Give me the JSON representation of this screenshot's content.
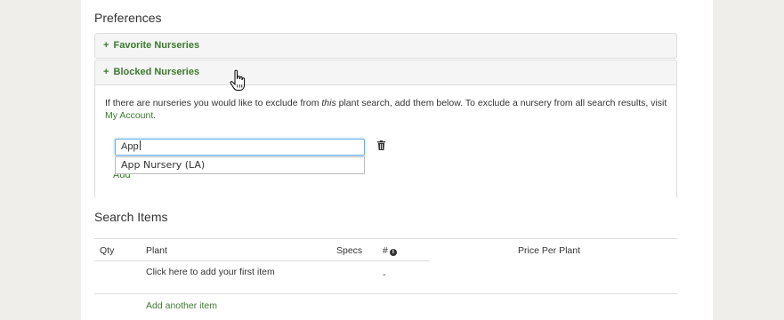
{
  "preferences": {
    "title": "Preferences",
    "favorite": {
      "label": "Favorite Nurseries"
    },
    "blocked": {
      "label": "Blocked Nurseries",
      "desc_before": "If there are nurseries you would like to exclude from ",
      "desc_italic": "this",
      "desc_after": " plant search, add them below. To exclude a nursery from all search results, visit ",
      "desc_link": "My Account",
      "desc_end": ".",
      "search_value": "App",
      "suggestion": "App Nursery (LA)",
      "add_label": "Add"
    }
  },
  "search_items": {
    "title": "Search Items",
    "columns": {
      "qty": "Qty",
      "plant": "Plant",
      "specs": "Specs",
      "count": "#",
      "price": "Price Per Plant"
    },
    "first_row": {
      "plant": "Click here to add your first item",
      "count": "-"
    },
    "add_another": "Add another item"
  },
  "icons": {
    "plus": "plus-icon",
    "trash": "trash-icon",
    "info": "info-icon",
    "cursor": "hand-pointer-icon"
  },
  "colors": {
    "accent": "#3c7a2f",
    "focus": "#66afe9"
  }
}
